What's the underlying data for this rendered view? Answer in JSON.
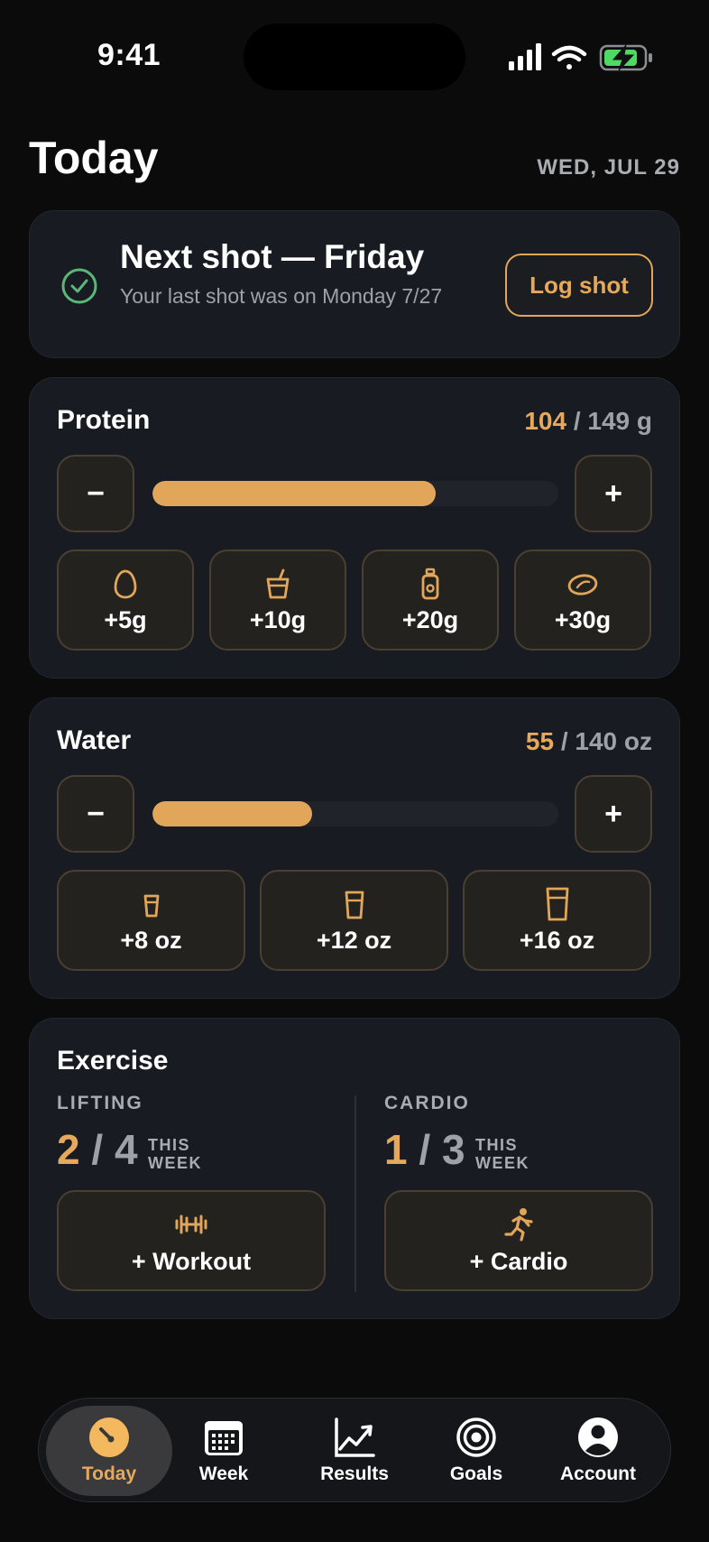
{
  "status": {
    "time": "9:41"
  },
  "header": {
    "title": "Today",
    "date": "WED, JUL 29"
  },
  "shot": {
    "title": "Next shot — Friday",
    "subtitle": "Your last shot was on Monday 7/27",
    "button": "Log shot"
  },
  "protein": {
    "label": "Protein",
    "current": "104",
    "target": "149 g",
    "progress": 0.698,
    "minus": "−",
    "plus": "+",
    "chips": [
      {
        "label": "+5g",
        "icon": "egg-icon"
      },
      {
        "label": "+10g",
        "icon": "cup-icon"
      },
      {
        "label": "+20g",
        "icon": "shake-bottle-icon"
      },
      {
        "label": "+30g",
        "icon": "steak-icon"
      }
    ]
  },
  "water": {
    "label": "Water",
    "current": "55",
    "target": "140 oz",
    "progress": 0.393,
    "minus": "−",
    "plus": "+",
    "chips": [
      {
        "label": "+8 oz",
        "icon": "small-glass-icon"
      },
      {
        "label": "+12 oz",
        "icon": "medium-glass-icon"
      },
      {
        "label": "+16 oz",
        "icon": "large-glass-icon"
      }
    ]
  },
  "exercise": {
    "label": "Exercise",
    "lifting": {
      "label": "LIFTING",
      "done": "2",
      "goal": "4",
      "period_line1": "THIS",
      "period_line2": "WEEK",
      "button": "+ Workout"
    },
    "cardio": {
      "label": "CARDIO",
      "done": "1",
      "goal": "3",
      "period_line1": "THIS",
      "period_line2": "WEEK",
      "button": "+ Cardio"
    }
  },
  "tabs": [
    {
      "label": "Today",
      "icon": "gauge-icon",
      "active": true
    },
    {
      "label": "Week",
      "icon": "calendar-icon",
      "active": false
    },
    {
      "label": "Results",
      "icon": "chart-icon",
      "active": false
    },
    {
      "label": "Goals",
      "icon": "target-icon",
      "active": false
    },
    {
      "label": "Account",
      "icon": "person-icon",
      "active": false
    }
  ],
  "colors": {
    "accent": "#e1a659",
    "background": "#0b0b0c",
    "card": "#181b21",
    "success": "#5cb67a"
  }
}
